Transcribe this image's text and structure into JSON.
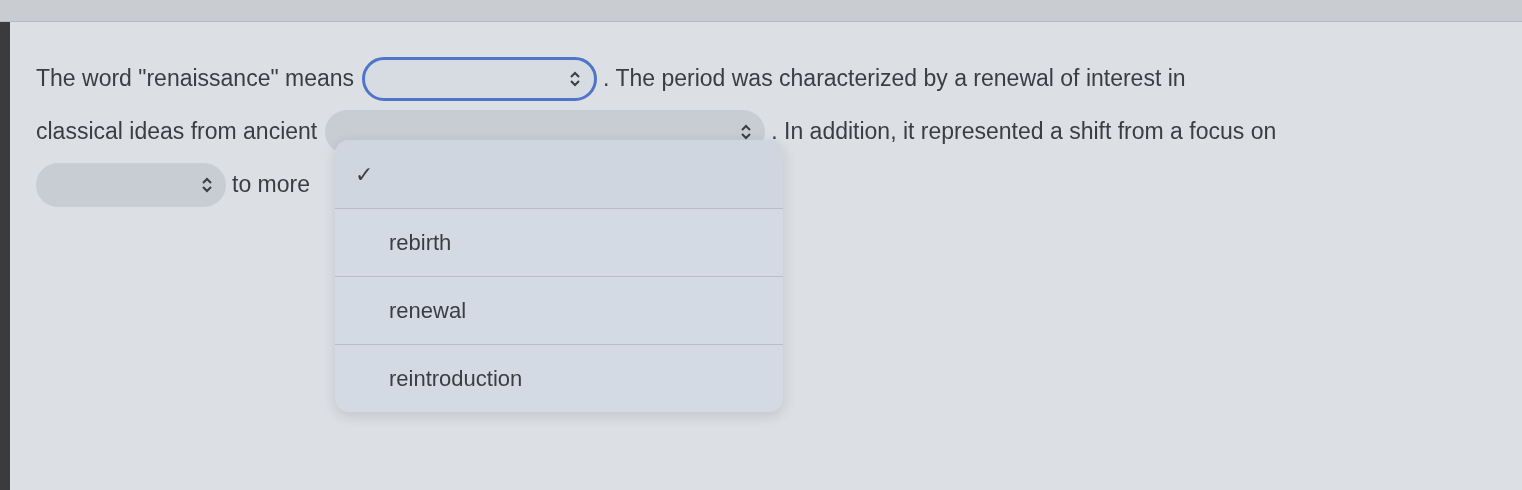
{
  "lines": [
    [
      {
        "kind": "text",
        "text": "The word \"renaissance\" means"
      },
      {
        "kind": "select",
        "focused": true
      },
      {
        "kind": "text",
        "text": ". The period was characterized by a renewal of interest in"
      }
    ],
    [
      {
        "kind": "text",
        "text": "classical ideas from ancient"
      },
      {
        "kind": "select",
        "focused": false
      },
      {
        "kind": "text",
        "text": ". In addition, it represented a shift from a focus on"
      }
    ],
    [
      {
        "kind": "select",
        "focused": false
      },
      {
        "kind": "text",
        "text": "to more"
      }
    ]
  ],
  "menu": {
    "check_mark": "✓",
    "blank_option": {
      "selected": true
    },
    "options": [
      {
        "label": "rebirth",
        "selected": false
      },
      {
        "label": "renewal",
        "selected": false
      },
      {
        "label": "reintroduction",
        "selected": false
      }
    ]
  }
}
